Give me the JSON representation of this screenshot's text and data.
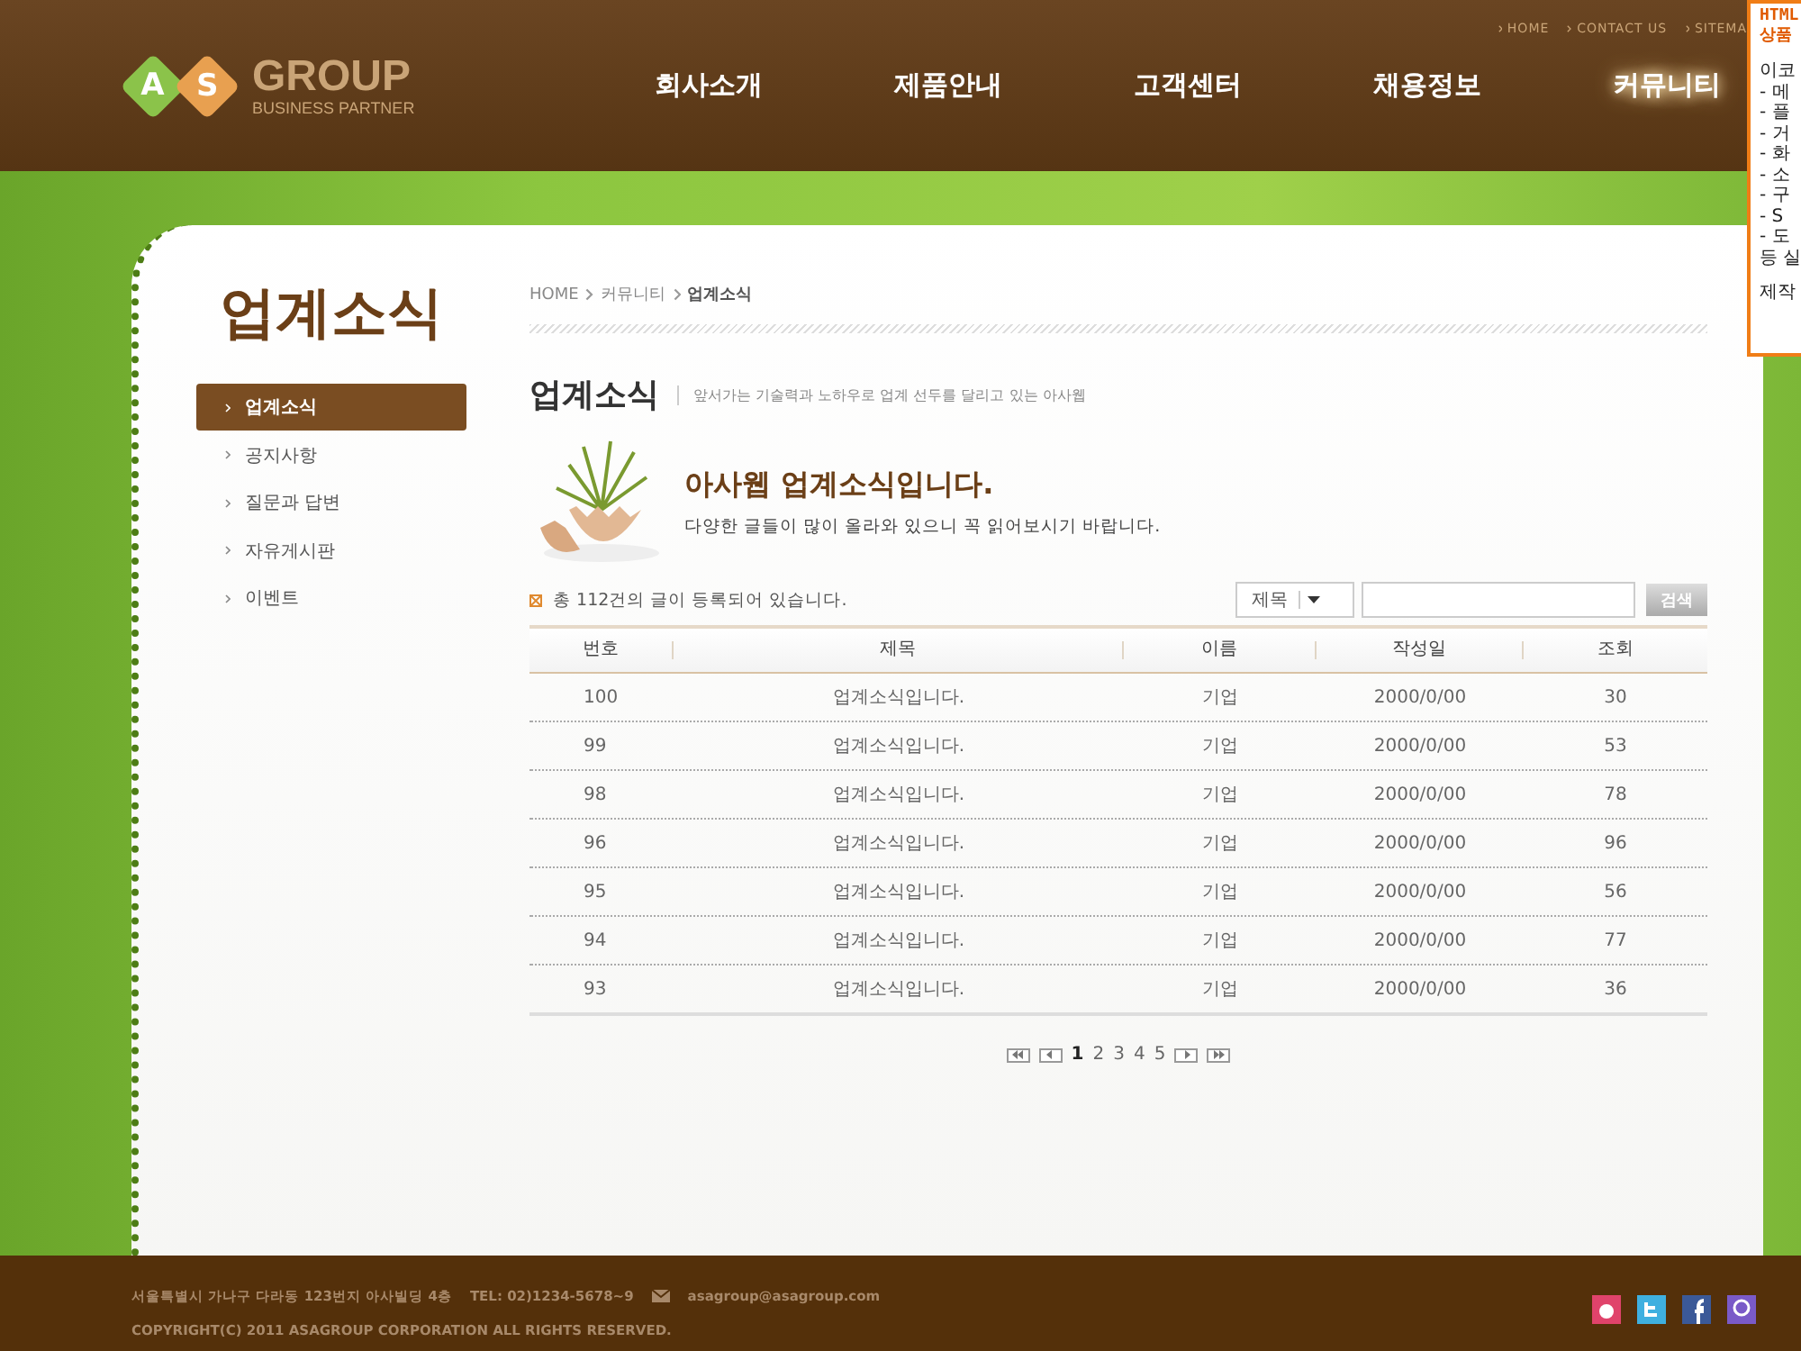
{
  "header": {
    "logo": {
      "mark_letters": [
        "A",
        "S"
      ],
      "name": "GROUP",
      "tagline": "BUSINESS PARTNER"
    },
    "top_links": [
      "HOME",
      "CONTACT US",
      "SITEMA"
    ],
    "nav": [
      {
        "label": "회사소개",
        "selected": false
      },
      {
        "label": "제품안내",
        "selected": false
      },
      {
        "label": "고객센터",
        "selected": false
      },
      {
        "label": "채용정보",
        "selected": false
      },
      {
        "label": "커뮤니티",
        "selected": true
      }
    ]
  },
  "side_panel": {
    "title_lines": [
      "HTML",
      "상품"
    ],
    "lines": [
      "이코",
      "- 메",
      "- 플",
      "- 거",
      "- 화",
      "- 소",
      "- 구",
      "- S",
      "- 도",
      "등 실",
      "제작"
    ]
  },
  "sidebar": {
    "title": "업계소식",
    "items": [
      {
        "label": "업계소식",
        "selected": true
      },
      {
        "label": "공지사항",
        "selected": false
      },
      {
        "label": "질문과 답변",
        "selected": false
      },
      {
        "label": "자유게시판",
        "selected": false
      },
      {
        "label": "이벤트",
        "selected": false
      }
    ]
  },
  "breadcrumb": [
    "HOME",
    "커뮤니티",
    "업계소식"
  ],
  "page_title": "업계소식",
  "page_subtitle": "앞서가는 기술력과 노하우로 업계 선두를 달리고 있는 아사웹",
  "intro": {
    "heading": "아사웹 업계소식입니다.",
    "text": "다양한 글들이 많이 올라와 있으니 꼭 읽어보시기 바랍니다."
  },
  "board": {
    "count_text": "총 112건의 글이 등록되어 있습니다.",
    "search": {
      "field_select": "제목",
      "button": "검색"
    },
    "columns": [
      "번호",
      "제목",
      "이름",
      "작성일",
      "조회"
    ],
    "rows": [
      [
        "100",
        "업계소식입니다.",
        "기업",
        "2000/0/00",
        "30"
      ],
      [
        "99",
        "업계소식입니다.",
        "기업",
        "2000/0/00",
        "53"
      ],
      [
        "98",
        "업계소식입니다.",
        "기업",
        "2000/0/00",
        "78"
      ],
      [
        "96",
        "업계소식입니다.",
        "기업",
        "2000/0/00",
        "96"
      ],
      [
        "95",
        "업계소식입니다.",
        "기업",
        "2000/0/00",
        "56"
      ],
      [
        "94",
        "업계소식입니다.",
        "기업",
        "2000/0/00",
        "77"
      ],
      [
        "93",
        "업계소식입니다.",
        "기업",
        "2000/0/00",
        "36"
      ]
    ],
    "pages": [
      {
        "label": "1",
        "selected": true
      },
      {
        "label": "2",
        "selected": false
      },
      {
        "label": "3",
        "selected": false
      },
      {
        "label": "4",
        "selected": false
      },
      {
        "label": "5",
        "selected": false
      }
    ]
  },
  "footer": {
    "address": "서울특별시 가나구 다라동 123번지 아사빌딩 4층",
    "tel": "TEL: 02)1234-5678~9",
    "email": "asagroup@asagroup.com",
    "copyright": "COPYRIGHT(C) 2011 ASAGROUP CORPORATION ALL RIGHTS RESERVED."
  }
}
